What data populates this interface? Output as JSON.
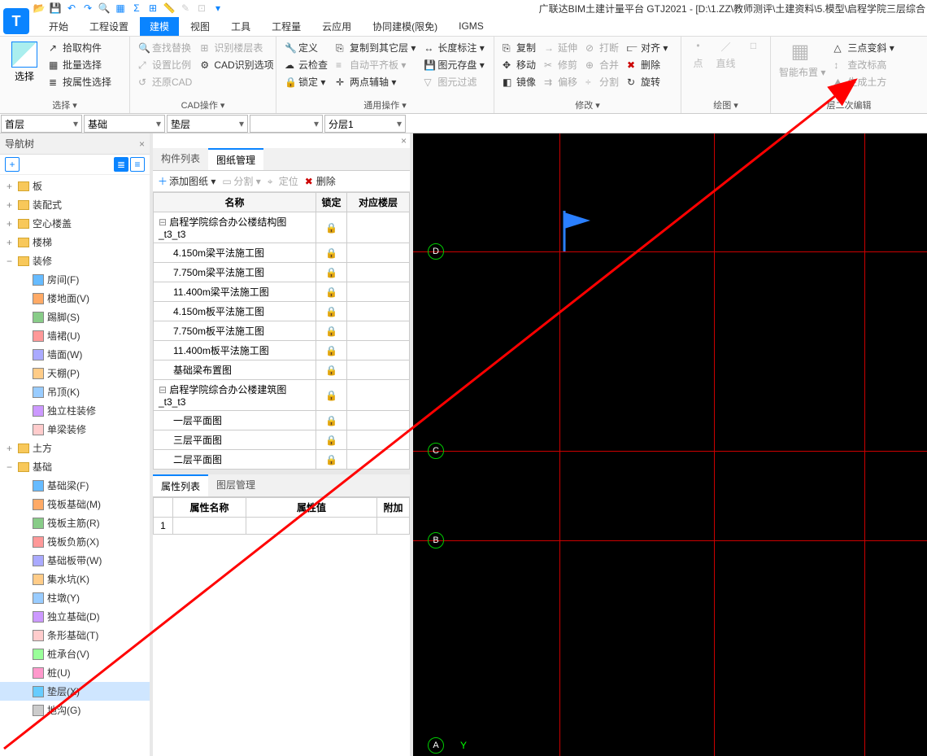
{
  "app": {
    "title": "广联达BIM土建计量平台 GTJ2021 - [D:\\1.ZZ\\教师测评\\土建资料\\5.模型\\启程学院三层综合"
  },
  "menus": [
    "开始",
    "工程设置",
    "建模",
    "视图",
    "工具",
    "工程量",
    "云应用",
    "协同建模(限免)",
    "IGMS"
  ],
  "active_menu": "建模",
  "ribbon": {
    "select_group": {
      "label": "选择 ▾",
      "big": "选择",
      "btns": [
        "拾取构件",
        "批量选择",
        "按属性选择"
      ]
    },
    "cad_group": {
      "label": "CAD操作 ▾",
      "btns": [
        [
          "查找替换",
          "识别楼层表"
        ],
        [
          "设置比例",
          "CAD识别选项"
        ],
        [
          "还原CAD",
          ""
        ]
      ]
    },
    "general_group": {
      "label": "通用操作 ▾",
      "btns": [
        [
          "定义",
          "复制到其它层 ▾",
          "长度标注 ▾"
        ],
        [
          "云检查",
          "自动平齐板 ▾",
          "图元存盘 ▾"
        ],
        [
          "锁定 ▾",
          "两点辅轴 ▾",
          "图元过滤"
        ]
      ]
    },
    "modify_group": {
      "label": "修改 ▾",
      "btns": [
        [
          "复制",
          "延伸",
          "打断",
          "对齐 ▾"
        ],
        [
          "移动",
          "修剪",
          "合并",
          "删除"
        ],
        [
          "镜像",
          "偏移",
          "分割",
          "旋转"
        ]
      ]
    },
    "draw_group": {
      "label": "绘图 ▾",
      "btns": [
        "点",
        "直线",
        "□"
      ]
    },
    "extra_group": {
      "btns": [
        "智能布置 ▾",
        "三点变斜 ▾",
        "查改标高",
        "生成土方"
      ],
      "footer": "层二次编辑"
    }
  },
  "selectors": [
    {
      "w": 100,
      "v": "首层"
    },
    {
      "w": 100,
      "v": "基础"
    },
    {
      "w": 100,
      "v": "垫层"
    },
    {
      "w": 90,
      "v": ""
    },
    {
      "w": 100,
      "v": "分层1"
    }
  ],
  "nav": {
    "title": "导航树",
    "groups": [
      {
        "t": "板",
        "items": []
      },
      {
        "t": "装配式",
        "items": []
      },
      {
        "t": "空心楼盖",
        "items": []
      },
      {
        "t": "楼梯",
        "items": []
      },
      {
        "t": "装修",
        "items": [
          "房间(F)",
          "楼地面(V)",
          "踢脚(S)",
          "墙裙(U)",
          "墙面(W)",
          "天棚(P)",
          "吊顶(K)",
          "独立柱装修",
          "单梁装修"
        ]
      },
      {
        "t": "土方",
        "items": []
      },
      {
        "t": "基础",
        "items": [
          "基础梁(F)",
          "筏板基础(M)",
          "筏板主筋(R)",
          "筏板负筋(X)",
          "基础板带(W)",
          "集水坑(K)",
          "柱墩(Y)",
          "独立基础(D)",
          "条形基础(T)",
          "桩承台(V)",
          "桩(U)",
          "垫层(X)",
          "地沟(G)"
        ]
      }
    ],
    "selected": "垫层(X)"
  },
  "middle": {
    "tabs": [
      "构件列表",
      "图纸管理"
    ],
    "active_tab": "图纸管理",
    "toolbar": {
      "add": "添加图纸 ▾",
      "split": "分割 ▾",
      "locate": "定位",
      "delete": "删除"
    },
    "cols": [
      "名称",
      "锁定",
      "对应楼层"
    ],
    "rows": [
      {
        "n": "启程学院综合办公楼结构图_t3_t3",
        "lv": 0
      },
      {
        "n": "4.150m梁平法施工图",
        "lv": 1
      },
      {
        "n": "7.750m梁平法施工图",
        "lv": 1
      },
      {
        "n": "11.400m梁平法施工图",
        "lv": 1
      },
      {
        "n": "4.150m板平法施工图",
        "lv": 1
      },
      {
        "n": "7.750m板平法施工图",
        "lv": 1
      },
      {
        "n": "11.400m板平法施工图",
        "lv": 1
      },
      {
        "n": "基础梁布置图",
        "lv": 1
      },
      {
        "n": "启程学院综合办公楼建筑图_t3_t3",
        "lv": 0
      },
      {
        "n": "一层平面图",
        "lv": 1
      },
      {
        "n": "三层平面图",
        "lv": 1
      },
      {
        "n": "二层平面图",
        "lv": 1
      }
    ],
    "prop_tabs": [
      "属性列表",
      "图层管理"
    ],
    "prop_active": "属性列表",
    "prop_cols": [
      "",
      "属性名称",
      "属性值",
      "附加"
    ],
    "prop_row1": "1"
  },
  "canvas": {
    "labels": [
      "A",
      "B",
      "C",
      "D"
    ],
    "y": "Y"
  }
}
